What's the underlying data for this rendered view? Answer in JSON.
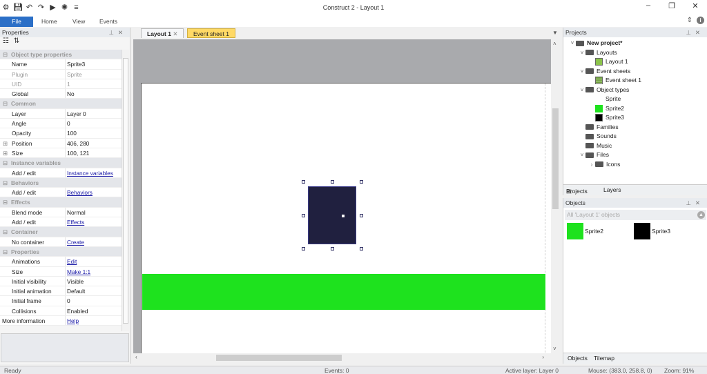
{
  "window": {
    "title": "Construct 2 - Layout 1",
    "quick_access_icons": [
      "app-logo-icon",
      "save-icon",
      "undo-icon",
      "redo-icon",
      "run-icon",
      "debug-icon",
      "customize-icon"
    ],
    "controls": {
      "minimize": "–",
      "restore": "❐",
      "close": "✕"
    }
  },
  "ribbon": {
    "tabs": [
      "File",
      "Home",
      "View",
      "Events"
    ]
  },
  "properties": {
    "title": "Properties",
    "rows": [
      {
        "type": "cat",
        "label": "Object type properties"
      },
      {
        "k": "Name",
        "v": "Sprite3"
      },
      {
        "k": "Plugin",
        "v": "Sprite",
        "dim": true
      },
      {
        "k": "UID",
        "v": "1",
        "dim": true
      },
      {
        "k": "Global",
        "v": "No"
      },
      {
        "type": "cat",
        "label": "Common"
      },
      {
        "k": "Layer",
        "v": "Layer 0"
      },
      {
        "k": "Angle",
        "v": "0"
      },
      {
        "k": "Opacity",
        "v": "100"
      },
      {
        "k": "Position",
        "v": "406, 280",
        "expand": true
      },
      {
        "k": "Size",
        "v": "100, 121",
        "expand": true
      },
      {
        "type": "cat",
        "label": "Instance variables"
      },
      {
        "k": "Add / edit",
        "v": "Instance variables",
        "link": true
      },
      {
        "type": "cat",
        "label": "Behaviors"
      },
      {
        "k": "Add / edit",
        "v": "Behaviors",
        "link": true
      },
      {
        "type": "cat",
        "label": "Effects"
      },
      {
        "k": "Blend mode",
        "v": "Normal"
      },
      {
        "k": "Add / edit",
        "v": "Effects",
        "link": true
      },
      {
        "type": "cat",
        "label": "Container"
      },
      {
        "k": "No container",
        "v": "Create",
        "link": true
      },
      {
        "type": "cat",
        "label": "Properties"
      },
      {
        "k": "Animations",
        "v": "Edit",
        "link": true
      },
      {
        "k": "Size",
        "v": "Make 1:1",
        "link": true
      },
      {
        "k": "Initial visibility",
        "v": "Visible"
      },
      {
        "k": "Initial animation",
        "v": "Default"
      },
      {
        "k": "Initial frame",
        "v": "0"
      },
      {
        "k": "Collisions",
        "v": "Enabled"
      },
      {
        "k": "More information",
        "v": "Help",
        "link": true,
        "top": true
      }
    ]
  },
  "editor": {
    "tabs": [
      {
        "label": "Layout 1",
        "active": true
      },
      {
        "label": "Event sheet 1",
        "active": false
      }
    ],
    "colors": {
      "green_sprite": "#1ee21e",
      "dark_sprite": "#20203f",
      "margin": "#a9aaad"
    }
  },
  "projects": {
    "title": "Projects",
    "tree": [
      {
        "label": "New project*",
        "depth": 0,
        "kind": "folder",
        "open": true,
        "bold": true
      },
      {
        "label": "Layouts",
        "depth": 1,
        "kind": "folder",
        "open": true
      },
      {
        "label": "Layout 1",
        "depth": 2,
        "kind": "layout"
      },
      {
        "label": "Event sheets",
        "depth": 1,
        "kind": "folder",
        "open": true
      },
      {
        "label": "Event sheet 1",
        "depth": 2,
        "kind": "eventsheet"
      },
      {
        "label": "Object types",
        "depth": 1,
        "kind": "folder",
        "open": true
      },
      {
        "label": "Sprite",
        "depth": 2,
        "kind": "none"
      },
      {
        "label": "Sprite2",
        "depth": 2,
        "kind": "green"
      },
      {
        "label": "Sprite3",
        "depth": 2,
        "kind": "black"
      },
      {
        "label": "Families",
        "depth": 1,
        "kind": "folder"
      },
      {
        "label": "Sounds",
        "depth": 1,
        "kind": "folder"
      },
      {
        "label": "Music",
        "depth": 1,
        "kind": "folder"
      },
      {
        "label": "Files",
        "depth": 1,
        "kind": "folder",
        "open": true
      },
      {
        "label": "Icons",
        "depth": 2,
        "kind": "folder",
        "collapsed": true
      }
    ],
    "bottom_tabs": [
      "Projects",
      "Layers"
    ]
  },
  "objects": {
    "title": "Objects",
    "filter": "All 'Layout 1' objects",
    "items": [
      {
        "label": "Sprite2",
        "color": "#1ee21e"
      },
      {
        "label": "Sprite3",
        "color": "#000000"
      }
    ],
    "bottom_tabs": [
      "Objects",
      "Tilemap"
    ]
  },
  "status": {
    "ready": "Ready",
    "events": "Events: 0",
    "active_layer": "Active layer: Layer 0",
    "mouse": "Mouse: (383.0, 258.8, 0)",
    "zoom": "Zoom: 91%"
  }
}
